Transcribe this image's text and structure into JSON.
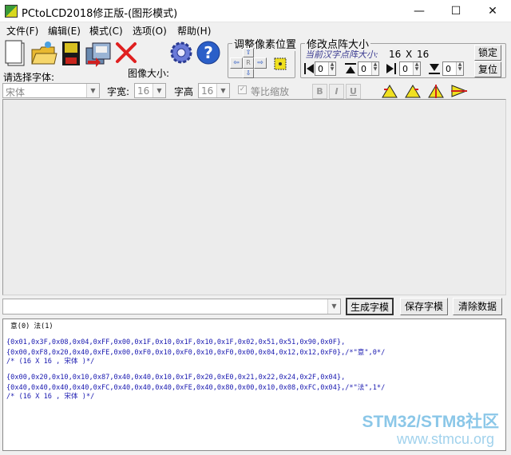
{
  "window": {
    "title": "PCtoLCD2018修正版-(图形模式)",
    "minimize": "—",
    "maximize": "☐",
    "close": "✕"
  },
  "menu": [
    {
      "label": "文件(F)"
    },
    {
      "label": "编辑(E)"
    },
    {
      "label": "模式(C)"
    },
    {
      "label": "选项(O)"
    },
    {
      "label": "帮助(H)"
    }
  ],
  "adjust_pixel": {
    "title": "调整像素位置",
    "center_label": "R"
  },
  "modify_matrix": {
    "title": "修改点阵大小",
    "current_label": "当前汉字点阵大小:",
    "size_w": "16",
    "size_x": "X",
    "size_h": "16",
    "values": [
      "0",
      "0",
      "0",
      "0"
    ],
    "lock_label": "锁定",
    "reset_label": "复位"
  },
  "font": {
    "select_label": "请选择字体:",
    "image_size_label": "图像大小:",
    "font_value": "宋体",
    "width_label": "字宽:",
    "width_value": "16",
    "height_label": "字高",
    "height_value": "16",
    "scale_label": "等比缩放",
    "bold": "B",
    "italic": "I",
    "underline": "U"
  },
  "actions": {
    "generate": "生成字模",
    "save": "保存字模",
    "clear": "清除数据"
  },
  "output": {
    "lines": [
      " 意(0) 法(1)",
      "",
      "{0x01,0x3F,0x08,0x04,0xFF,0x00,0x1F,0x10,0x1F,0x10,0x1F,0x02,0x51,0x51,0x90,0x0F},",
      "{0x00,0xF8,0x20,0x40,0xFE,0x00,0xF0,0x10,0xF0,0x10,0xF0,0x00,0x04,0x12,0x12,0xF0},/*\"意\",0*/",
      "/* (16 X 16 , 宋体 )*/",
      "",
      "{0x00,0x20,0x10,0x10,0x87,0x40,0x40,0x10,0x1F,0x20,0xE0,0x21,0x22,0x24,0x2F,0x04},",
      "{0x40,0x40,0x40,0x40,0xFC,0x40,0x40,0x40,0xFE,0x40,0x80,0x00,0x10,0x08,0xFC,0x04},/*\"法\",1*/",
      "/* (16 X 16 , 宋体 )*/"
    ]
  },
  "watermark": {
    "brand": "STM32/STM8社区",
    "url": "www.stmcu.org"
  }
}
